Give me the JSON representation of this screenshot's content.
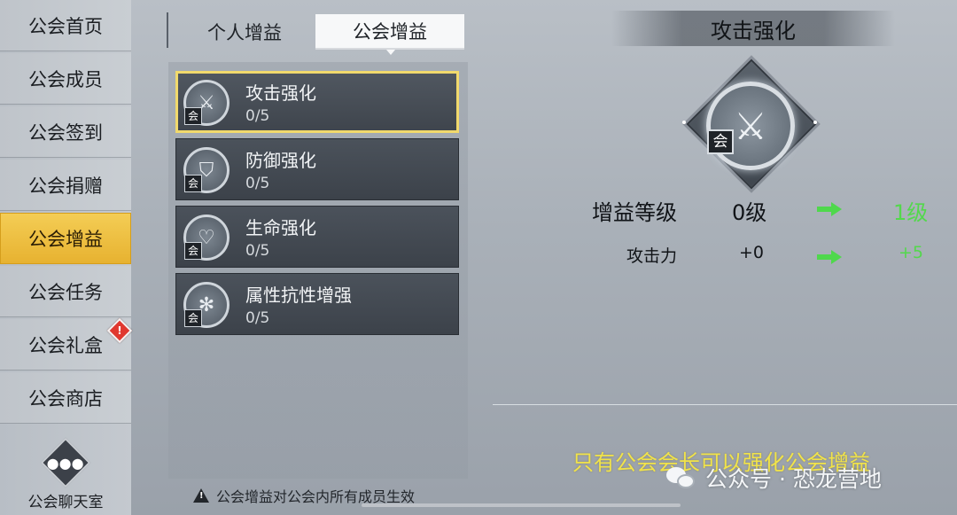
{
  "sidebar": {
    "items": [
      {
        "label": "公会首页",
        "active": false
      },
      {
        "label": "公会成员",
        "active": false
      },
      {
        "label": "公会签到",
        "active": false
      },
      {
        "label": "公会捐赠",
        "active": false
      },
      {
        "label": "公会增益",
        "active": true
      },
      {
        "label": "公会任务",
        "active": false
      },
      {
        "label": "公会礼盒",
        "active": false,
        "badge": "!"
      },
      {
        "label": "公会商店",
        "active": false
      }
    ],
    "chat_label": "公会聊天室",
    "chat_icon": "chat-bubble-icon"
  },
  "tabs": [
    {
      "label": "个人增益",
      "active": false
    },
    {
      "label": "公会增益",
      "active": true
    }
  ],
  "buffs": [
    {
      "name": "攻击强化",
      "level": "0/5",
      "icon": "crossed-swords-icon",
      "tag": "会",
      "selected": true
    },
    {
      "name": "防御强化",
      "level": "0/5",
      "icon": "shield-icon",
      "tag": "会",
      "selected": false
    },
    {
      "name": "生命强化",
      "level": "0/5",
      "icon": "heart-icon",
      "tag": "会",
      "selected": false
    },
    {
      "name": "属性抗性增强",
      "level": "0/5",
      "icon": "elements-icon",
      "tag": "会",
      "selected": false
    }
  ],
  "notice": "公会增益对公会内所有成员生效",
  "detail": {
    "title": "攻击强化",
    "icon": "crossed-swords-icon",
    "tag": "会",
    "stats": [
      {
        "label": "增益等级",
        "from": "0级",
        "to": "1级"
      },
      {
        "label": "攻击力",
        "from": "+0",
        "to": "+5"
      }
    ],
    "hint": "只有公会会长可以强化公会增益"
  },
  "watermark": "公众号 · 恐龙营地",
  "colors": {
    "active_tab_gold": "#f4cd55",
    "selected_border": "#f1d96c",
    "arrow_green": "#4fd84c",
    "hint_yellow": "#f1e34a"
  }
}
